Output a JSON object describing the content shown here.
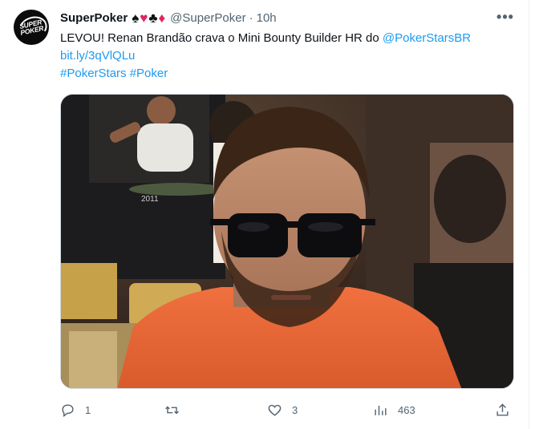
{
  "author": {
    "display_name": "SuperPoker",
    "suits": [
      "♠",
      "♥",
      "♣",
      "♦"
    ],
    "handle": "@SuperPoker",
    "separator": "·",
    "time": "10h",
    "avatar_text": "SUPER POKER"
  },
  "tweet": {
    "text_prefix": "LEVOU! Renan Brandão crava o Mini Bounty Builder HR do ",
    "mention": "@PokerStarsBR",
    "link": "bit.ly/3qVlQLu",
    "hashtags": "#PokerStars #Poker"
  },
  "media": {
    "background_year": "2011"
  },
  "actions": {
    "replies": "1",
    "retweets": "",
    "likes": "3",
    "views": "463"
  },
  "colors": {
    "link": "#1d9bf0",
    "muted": "#536471",
    "suit_red": "#e0245e"
  }
}
